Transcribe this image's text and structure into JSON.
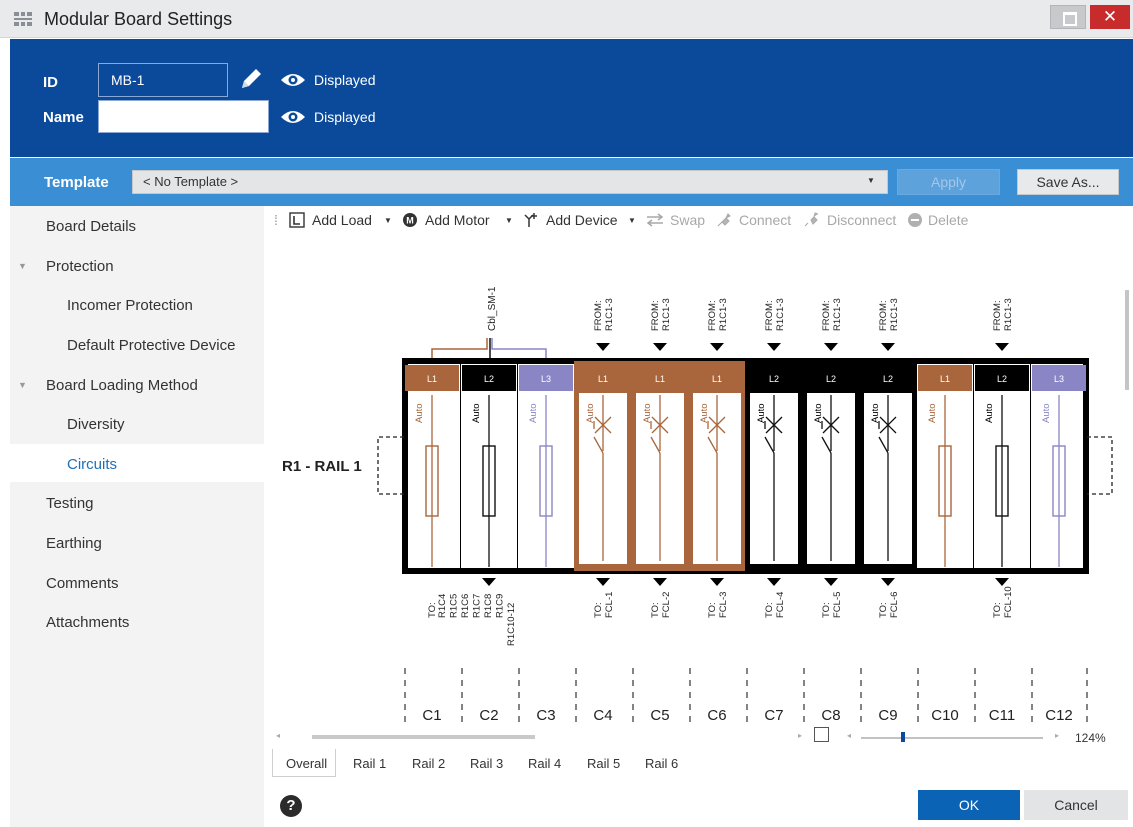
{
  "window": {
    "title": "Modular Board Settings",
    "close_glyph": "✕"
  },
  "header": {
    "id_label": "ID",
    "id_value": "MB-1",
    "name_label": "Name",
    "name_value": "",
    "id_display": "Displayed",
    "name_display": "Displayed"
  },
  "template": {
    "label": "Template",
    "selected": "< No Template >",
    "apply_label": "Apply",
    "saveas_label": "Save As..."
  },
  "sidebar": {
    "items": [
      {
        "label": "Board Details"
      },
      {
        "label": "Protection"
      },
      {
        "label": "Incomer Protection"
      },
      {
        "label": "Default Protective Device"
      },
      {
        "label": "Board Loading Method"
      },
      {
        "label": "Diversity"
      },
      {
        "label": "Circuits"
      },
      {
        "label": "Testing"
      },
      {
        "label": "Earthing"
      },
      {
        "label": "Comments"
      },
      {
        "label": "Attachments"
      }
    ],
    "selected": "Circuits"
  },
  "toolbar": {
    "add_load": "Add Load",
    "add_motor": "Add Motor",
    "add_device": "Add Device",
    "swap": "Swap",
    "connect": "Connect",
    "disconnect": "Disconnect",
    "delete": "Delete"
  },
  "colors": {
    "L1": "#a9663c",
    "L2": "#111111",
    "L3": "#8a86c6",
    "header_blue": "#0b4a9a",
    "template_blue": "#3a8fd4"
  },
  "board": {
    "rail_label": "R1 - RAIL 1",
    "incoming_cable": "Cbl_SM-1",
    "from_label": "FROM:",
    "from_ref": "R1C1-3",
    "to_label": "TO:",
    "mode_label": "Auto",
    "circuits": [
      {
        "name": "C1",
        "phase": "L1",
        "device": "fuse"
      },
      {
        "name": "C2",
        "phase": "L2",
        "device": "fuse"
      },
      {
        "name": "C3",
        "phase": "L3",
        "device": "fuse"
      },
      {
        "name": "C4",
        "phase": "L1",
        "device": "breaker",
        "from": true,
        "to": "FCL-1"
      },
      {
        "name": "C5",
        "phase": "L1",
        "device": "breaker",
        "from": true,
        "to": "FCL-2"
      },
      {
        "name": "C6",
        "phase": "L1",
        "device": "breaker",
        "from": true,
        "to": "FCL-3"
      },
      {
        "name": "C7",
        "phase": "L2",
        "device": "breaker",
        "from": true,
        "to": "FCL-4"
      },
      {
        "name": "C8",
        "phase": "L2",
        "device": "breaker",
        "from": true,
        "to": "FCL-5"
      },
      {
        "name": "C9",
        "phase": "L2",
        "device": "breaker",
        "from": true,
        "to": "FCL-6"
      },
      {
        "name": "C10",
        "phase": "L1",
        "device": "fuse"
      },
      {
        "name": "C11",
        "phase": "L2",
        "device": "fuse",
        "from": true,
        "to": "FCL-10"
      },
      {
        "name": "C12",
        "phase": "L3",
        "device": "fuse"
      }
    ],
    "group_to_refs": [
      "R1C4",
      "R1C5",
      "R1C6",
      "R1C7",
      "R1C8",
      "R1C9",
      "R1C10-12"
    ]
  },
  "zoom": {
    "level": "124%",
    "slider_fraction": 0.23
  },
  "tabs": [
    "Overall",
    "Rail 1",
    "Rail 2",
    "Rail 3",
    "Rail 4",
    "Rail 5",
    "Rail 6"
  ],
  "footer": {
    "help_glyph": "?",
    "ok_label": "OK",
    "cancel_label": "Cancel"
  }
}
